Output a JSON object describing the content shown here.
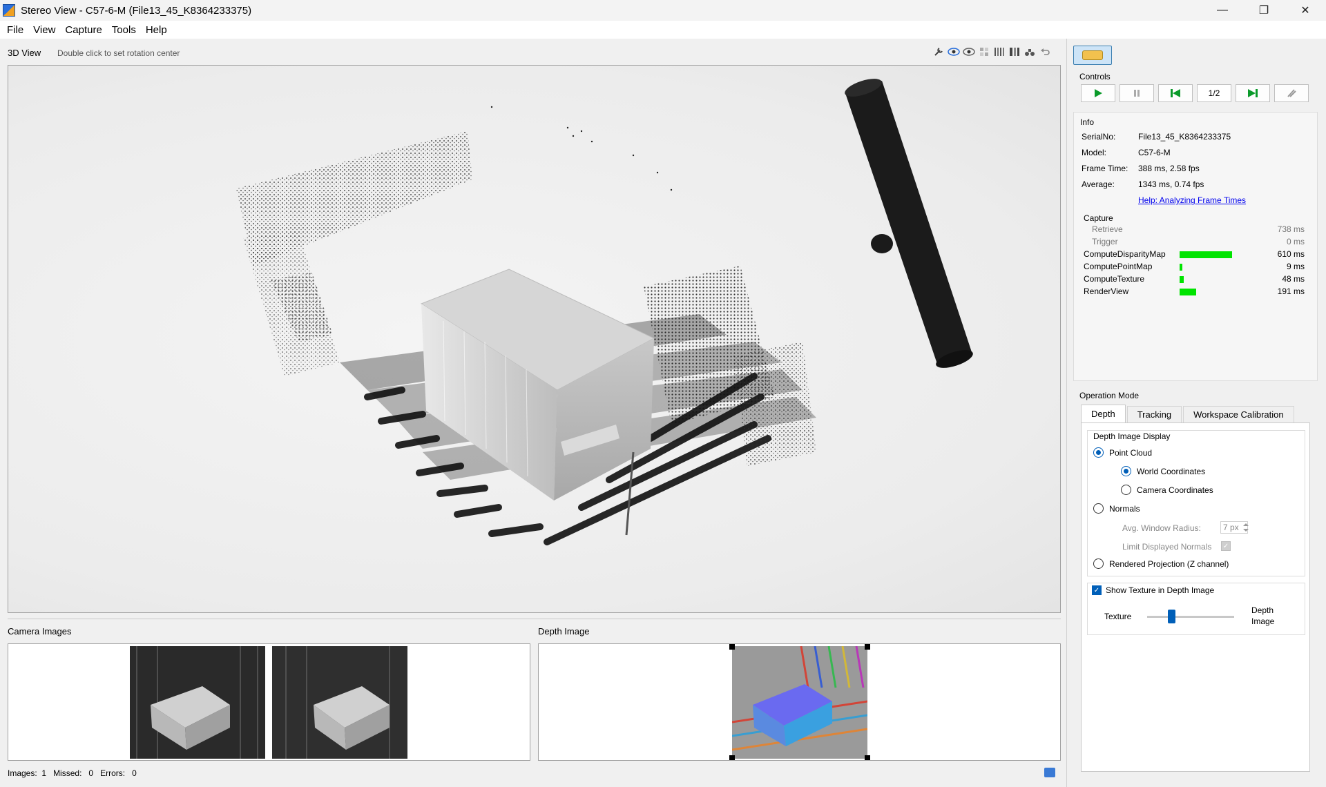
{
  "window": {
    "title": "Stereo View - C57-6-M (File13_45_K8364233375)",
    "buttons": {
      "minimize": "—",
      "restore": "❐",
      "close": "✕"
    }
  },
  "menu": [
    "File",
    "View",
    "Capture",
    "Tools",
    "Help"
  ],
  "view3d": {
    "label": "3D View",
    "hint": "Double click to set rotation center",
    "toolbar_icons": [
      "settings-icon",
      "eye-icon",
      "eye-icon",
      "grid-icon",
      "stripes-icon",
      "stripes-icon",
      "binoculars-icon",
      "undo-icon"
    ]
  },
  "panes": {
    "camera_label": "Camera Images",
    "depth_label": "Depth Image"
  },
  "status": {
    "images_label": "Images:",
    "images": "1",
    "missed_label": "Missed:",
    "missed": "0",
    "errors_label": "Errors:",
    "errors": "0"
  },
  "controls": {
    "title": "Controls",
    "counter": "1/2",
    "colors": {
      "play": "#0a9a2a",
      "accent": "#005fb8",
      "bar": "#00e400"
    }
  },
  "info": {
    "title": "Info",
    "rows": [
      {
        "key": "SerialNo:",
        "value": "File13_45_K8364233375"
      },
      {
        "key": "Model:",
        "value": "C57-6-M"
      },
      {
        "key": "Frame Time:",
        "value": "388 ms, 2.58 fps"
      },
      {
        "key": "Average:",
        "value": "1343 ms, 0.74 fps"
      }
    ],
    "help_link": "Help: Analyzing Frame Times",
    "capture_title": "Capture",
    "capture": [
      {
        "name": "Retrieve",
        "value": "738 ms",
        "ms": 738,
        "sub": true
      },
      {
        "name": "Trigger",
        "value": "0 ms",
        "ms": 0,
        "sub": true
      },
      {
        "name": "ComputeDisparityMap",
        "value": "610 ms",
        "ms": 610,
        "sub": false
      },
      {
        "name": "ComputePointMap",
        "value": "9 ms",
        "ms": 9,
        "sub": false
      },
      {
        "name": "ComputeTexture",
        "value": "48 ms",
        "ms": 48,
        "sub": false
      },
      {
        "name": "RenderView",
        "value": "191 ms",
        "ms": 191,
        "sub": false
      }
    ]
  },
  "operation": {
    "title": "Operation Mode",
    "tabs": [
      "Depth",
      "Tracking",
      "Workspace Calibration"
    ],
    "active_tab": "Depth",
    "depth_display_title": "Depth Image Display",
    "point_cloud": "Point Cloud",
    "world_coords": "World Coordinates",
    "camera_coords": "Camera Coordinates",
    "normals": "Normals",
    "avg_window_label": "Avg. Window Radius:",
    "avg_window_value": "7 px",
    "limit_normals": "Limit Displayed Normals",
    "rendered_projection": "Rendered Projection (Z channel)",
    "show_texture": "Show Texture in Depth Image",
    "texture_label": "Texture",
    "depth_label_1": "Depth",
    "depth_label_2": "Image",
    "texture_mix": 0.28
  }
}
